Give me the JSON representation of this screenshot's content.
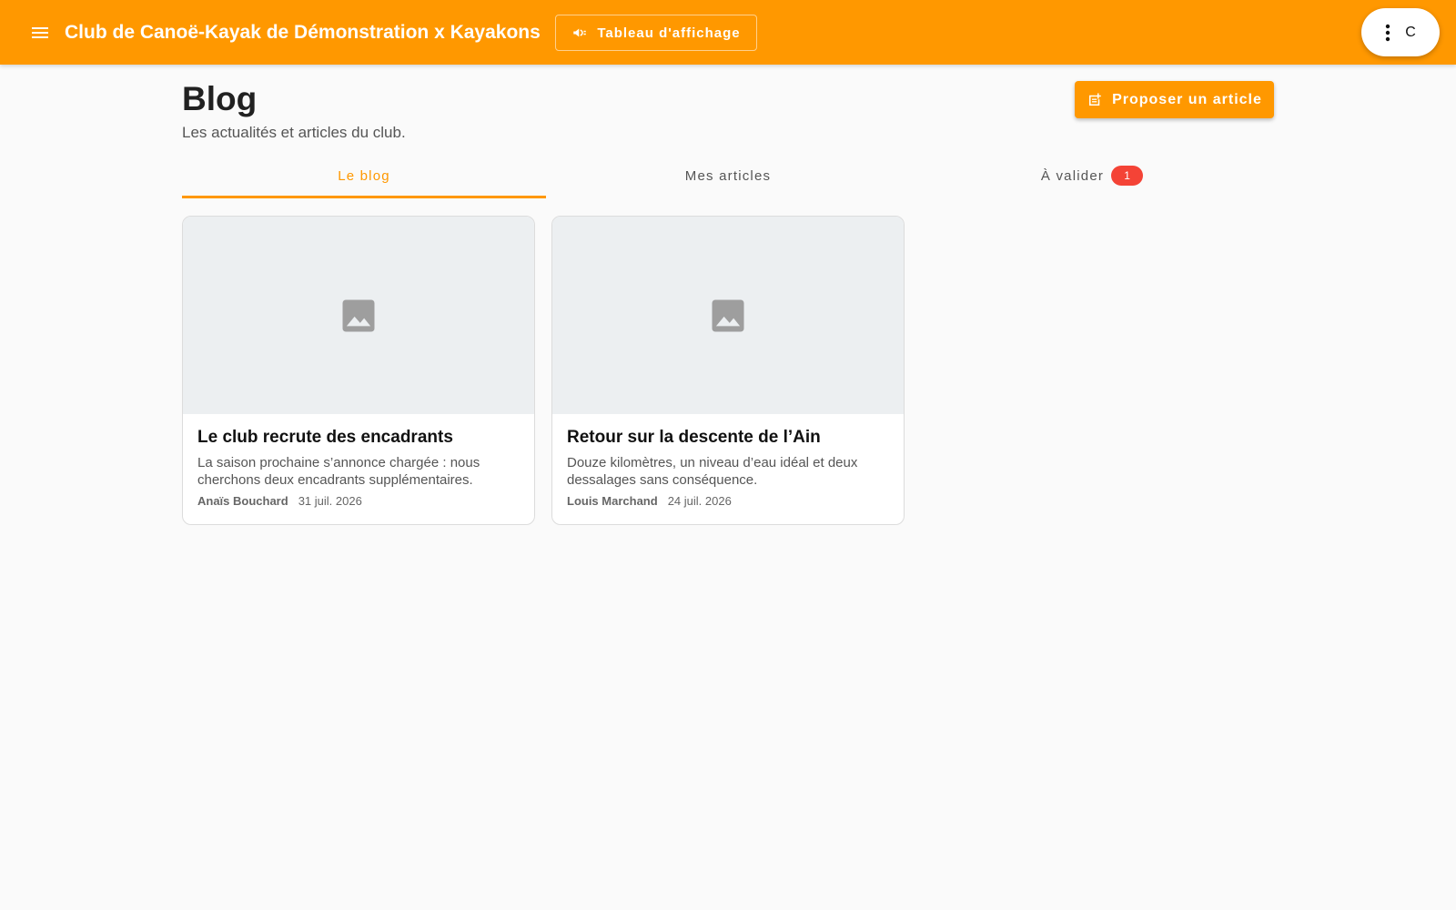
{
  "header": {
    "title": "Club de Canoë-Kayak de Démonstration x Kayakons",
    "board_label": "Tableau d'affichage",
    "avatar_letter": "C",
    "menu_icon": "menu-icon",
    "board_icon": "megaphone-icon",
    "more_icon": "more-vertical-icon",
    "color": "#ff9800"
  },
  "page": {
    "title": "Blog",
    "subtitle": "Les actualités et articles du club.",
    "propose_label": "Proposer un article",
    "propose_icon": "post-add-icon"
  },
  "tabs": [
    {
      "label": "Le blog",
      "active": true
    },
    {
      "label": "Mes articles",
      "active": false
    },
    {
      "label": "À valider",
      "active": false,
      "badge": "1"
    }
  ],
  "articles": [
    {
      "title": "Le club recrute des encadrants",
      "excerpt": "La saison prochaine s’annonce chargée : nous cherchons deux encadrants supplémentaires.",
      "author": "Anaïs Bouchard",
      "date": "31 juil. 2026",
      "image_icon": "image-placeholder-icon"
    },
    {
      "title": "Retour sur la descente de l’Ain",
      "excerpt": "Douze kilomètres, un niveau d’eau idéal et deux dessalages sans conséquence.",
      "author": "Louis Marchand",
      "date": "24 juil. 2026",
      "image_icon": "image-placeholder-icon"
    }
  ],
  "colors": {
    "accent": "#ff9800",
    "badge": "#f44336",
    "background": "#fafafa"
  }
}
